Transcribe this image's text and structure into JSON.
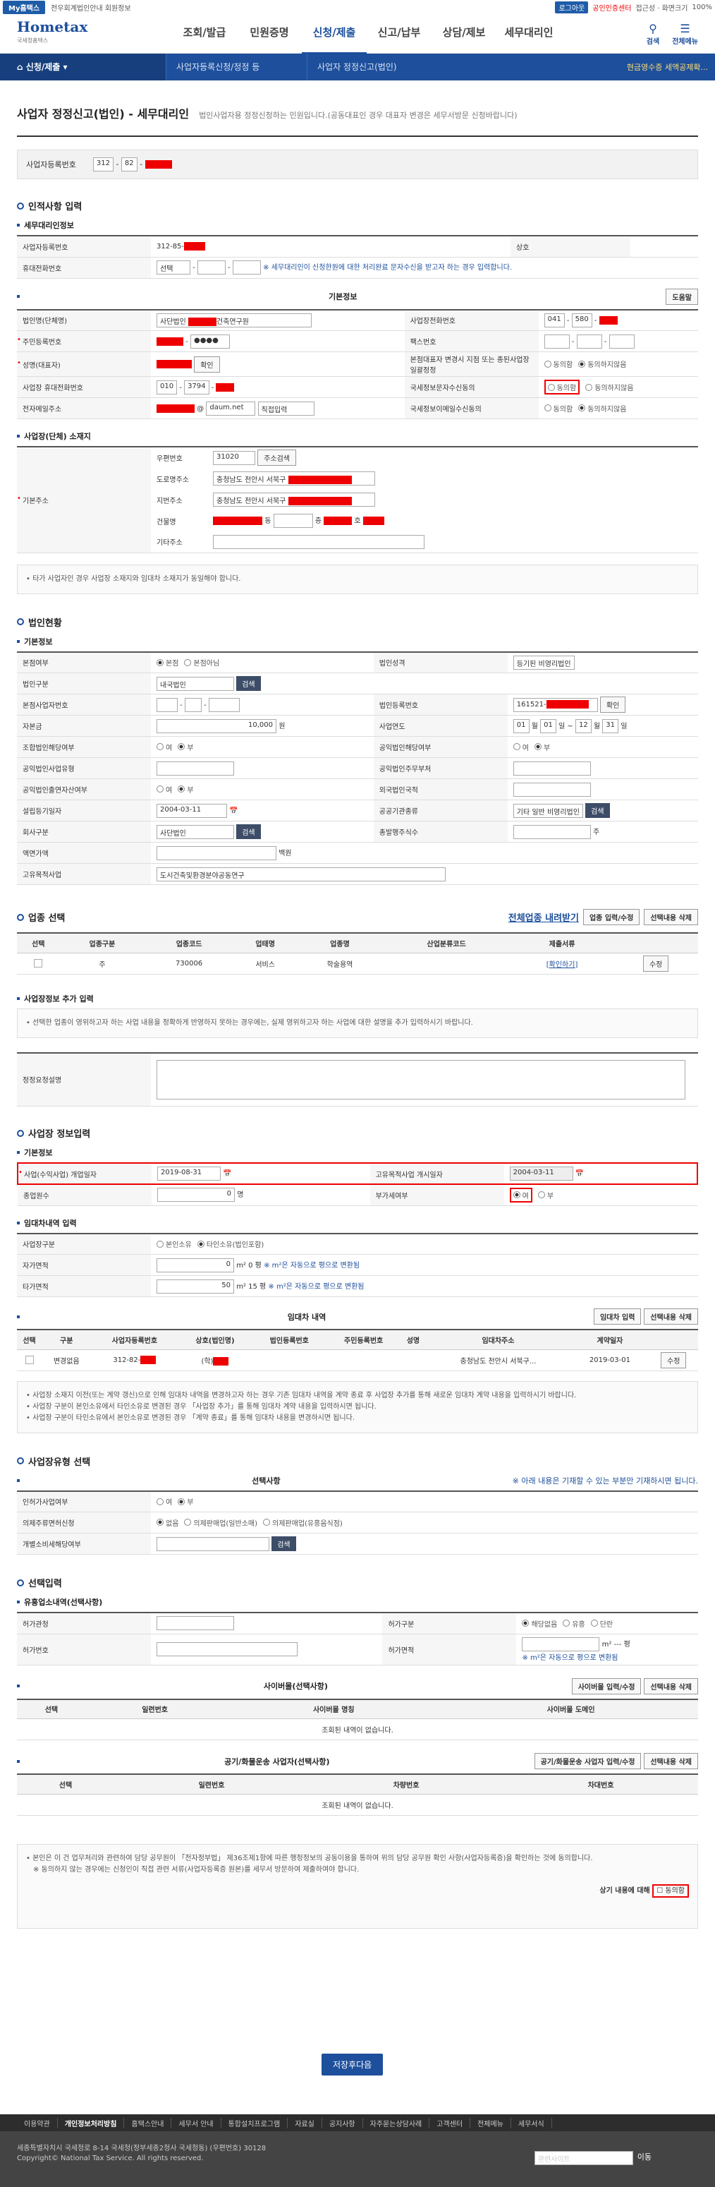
{
  "top": {
    "mytax": "My홈택스",
    "links": "전우회계법인안내  회원정보",
    "login": "로그아웃",
    "cert": "공인인증센터",
    "rest": "접근성 · 화면크기",
    "zoom": "100%"
  },
  "header": {
    "logo": "Hometax",
    "logo_sub": "국세청홈택스",
    "menus": [
      "조회/발급",
      "민원증명",
      "신청/제출",
      "신고/납부",
      "상담/제보",
      "세무대리인"
    ],
    "search": "검색",
    "allmenu": "전체메뉴"
  },
  "crumb": {
    "home": "신청/제출",
    "c1": "사업자등록신청/정정 등",
    "c2": "사업자 정정신고(법인)",
    "right": "현금영수증 세액공제확..."
  },
  "title": "사업자 정정신고(법인) - 세무대리인",
  "title_desc": "법인사업자용 정정신청하는 민원입니다.(공동대표인 경우 대표자 변경은 세무서방문 신청바랍니다)",
  "bizno_label": "사업자등록번호",
  "bizno": [
    "312",
    "82"
  ],
  "s1": {
    "title": "인적사항 입력",
    "agent": "세무대리인정보",
    "agent_bizno_l": "사업자등록번호",
    "agent_bizno": "312-85-",
    "trade_l": "상호",
    "phone_l": "휴대전화번호",
    "phone_sel": "선택",
    "phone_note": "※ 세무대리인이 신청한원에 대한 처리완료 문자수신을 받고자 하는 경우 입력합니다.",
    "basic": "기본정보",
    "help": "도움말",
    "corp_l": "법인명(단체명)",
    "corp": "사단법인",
    "corp2": "건축연구원",
    "biztel_l": "사업장전화번호",
    "biztel": [
      "041",
      "580"
    ],
    "jumin_l": "주민등록번호",
    "fax_l": "팩스번호",
    "rep_l": "성명(대표자)",
    "confirm": "확인",
    "unify_l": "본점대표자 변경시 지점 또는 종된사업장 일괄정정",
    "agree": "동의함",
    "disagree": "동의하지않음",
    "mobile_l": "사업장 휴대전화번호",
    "mobile": [
      "010",
      "3794"
    ],
    "sms_l": "국세정보문자수신동의",
    "email_l": "전자메일주소",
    "email": "daum.net",
    "email_sel": "직접입력",
    "email_agree_l": "국세정보이메일수신동의",
    "addr": "사업장(단체) 소재지",
    "addr_l": "기본주소",
    "zip_l": "우편번호",
    "zip": "31020",
    "zip_btn": "주소검색",
    "road_l": "도로명주소",
    "road": "충청남도 천안시 서북구",
    "lot_l": "지번주소",
    "lot": "충청남도 천안시 서북구",
    "bldg_l": "건물명",
    "dong": "동",
    "cheung": "층",
    "ho": "호",
    "etc_l": "기타주소",
    "addr_note": "• 타가 사업자인 경우 사업장 소재지와 임대차 소재지가 동일해야 합니다."
  },
  "s2": {
    "title": "법인현황",
    "basic": "기본정보",
    "hq_l": "본점여부",
    "hq": "본점",
    "nohq": "본점아님",
    "nature_l": "법인성격",
    "nature": "등기된 비영리법인",
    "kind_l": "법인구분",
    "kind": "내국법인",
    "search": "검색",
    "hqbiz_l": "본점사업자번호",
    "regno_l": "법인등록번호",
    "regno": "161521-",
    "capital_l": "자본금",
    "capital": "10,000",
    "won": "원",
    "fy_l": "사업연도",
    "fy": [
      "01",
      "01",
      "12",
      "31"
    ],
    "m": "월",
    "d": "일",
    "tilde": "~",
    "coop_l": "조합법인해당여부",
    "yes": "여",
    "no": "부",
    "public_l": "공익법인해당여부",
    "pubtype_l": "공익법인사업유형",
    "pubmain_l": "공익법인주무부처",
    "pubforeign_l": "공익법인출연자산여부",
    "foreign_l": "외국법인국적",
    "estdate_l": "설립등기일자",
    "estdate": "2004-03-11",
    "pubinst_l": "공공기관종류",
    "pubinst": "기타 일반 비영리법인",
    "company_l": "회사구분",
    "company": "사단법인",
    "shares_l": "총발행주식수",
    "ju": "주",
    "face_l": "액면가액",
    "face_unit": "백원",
    "purpose_l": "고유목적사업",
    "purpose": "도시건축및환경분야공동연구"
  },
  "s3": {
    "title": "업종 선택",
    "link": "전체업종 내려받기",
    "btn1": "업종 입력/수정",
    "btn2": "선택내용 삭제",
    "cols": [
      "선택",
      "업종구분",
      "업종코드",
      "업태명",
      "업종명",
      "산업분류코드",
      "제출서류"
    ],
    "row": [
      "주",
      "730006",
      "서비스",
      "학술용역",
      "[확인하기]",
      "수정"
    ],
    "extra": "사업장정보 추가 입력",
    "extra_note": "• 선택한 업종이 영위하고자 하는 사업 내용을 정확하게 반영하지 못하는 경우에는, 실제 영위하고자 하는 사업에 대한 설명을 추가 입력하시기 바랍니다.",
    "extra_l": "정정요청설명"
  },
  "s4": {
    "title": "사업장 정보입력",
    "basic": "기본정보",
    "open_l": "사업(수익사업) 개업일자",
    "open": "2019-08-31",
    "start_l": "고유목적사업 개시일자",
    "start": "2004-03-11",
    "emp_l": "종업원수",
    "emp": "0",
    "myeong": "명",
    "vat_l": "부가세여부",
    "vat_yes": "여",
    "vat_no": "부",
    "lease": "임대차내역 입력",
    "own_l": "사업장구분",
    "own": "본인소유",
    "rent": "타인소유(법인포함)",
    "selfarea_l": "자가면적",
    "selfarea": "0",
    "area_unit": "m²",
    "pyeong0": "0 평",
    "conv": "※ m²은 자동으로 평으로 변환됨",
    "otherarea_l": "타가면적",
    "otherarea": "50",
    "pyeong15": "15 평",
    "lease_list": "임대차 내역",
    "lease_btn1": "임대차 입력",
    "lease_btn2": "선택내용 삭제",
    "lcols": [
      "선택",
      "구분",
      "사업자등록번호",
      "상호(법인명)",
      "법인등록번호",
      "주민등록번호",
      "성명",
      "임대차주소",
      "계약일자"
    ],
    "lrow": [
      "변경없음",
      "312-82-",
      "(학)",
      "충청남도 천안시 서북구...",
      "2019-03-01",
      "수정"
    ],
    "lnote1": "사업장 소재지 이전(또는 계약 갱신)으로 인해 임대차 내역을 변경하고자 하는 경우 기존 임대차 내역을 계약 종료 후 사업장 추가를 통해 새로운 임대차 계약 내용을 입력하시기 바랍니다.",
    "lnote2": "사업장 구분이 본인소유에서 타인소유로 변경된 경우 「사업장 추가」를 통해 임대차 계약 내용을 입력하시면 됩니다.",
    "lnote3": "사업장 구분이 타인소유에서 본인소유로 변경된 경우 「계약 종료」를 통해 임대차 내용을 변경하시면 됩니다."
  },
  "s5": {
    "title": "사업장유형 선택",
    "basic": "선택사항",
    "hint": "※ 아래 내용은 기재할 수 있는 부분만 기재하시면 됩니다.",
    "license_l": "인허가사업여부",
    "exempt_l": "의제주류면허신청",
    "none": "없음",
    "ex1": "의제판매업(일반소매)",
    "ex2": "의제판매업(유흥음식점)",
    "tax_l": "개별소비세해당여부",
    "search": "검색"
  },
  "s6": {
    "title": "선택입력",
    "sub": "유흥업소내역(선택사항)",
    "office_l": "허가관청",
    "kind_l": "허가구분",
    "kinds": [
      "해당없음",
      "유흥",
      "단란"
    ],
    "permit_l": "허가번호",
    "area_l": "허가면적",
    "area_unit": "m²",
    "pyeong": "--- 평",
    "conv": "※ m²은 자동으로 평으로 변환됨",
    "cyber": "사이버몰(선택사항)",
    "cyber_btn1": "사이버몰 입력/수정",
    "cyber_btn2": "선택내용 삭제",
    "ccols": [
      "선택",
      "일련번호",
      "사이버몰 명칭",
      "사이버몰 도메인"
    ],
    "empty": "조회된 내역이 없습니다.",
    "ship": "공기/화물운송 사업자(선택사항)",
    "ship_btn1": "공기/화물운송 사업자 입력/수정",
    "ship_btn2": "선택내용 삭제",
    "scols": [
      "선택",
      "일련번호",
      "차량번호",
      "차대번호"
    ]
  },
  "consent": {
    "text": "• 본인은 이 건 업무처리와 관련하여 담당 공무원이 「전자정부법」 제36조제1항에 따른 행정정보의 공동이용을 통하여 위의 담당 공무원 확인 사항(사업자등록증)을 확인하는 것에 동의합니다.",
    "text2": "※ 동의하지 않는 경우에는 신청인이 직접 관련 서류(사업자등록증 원본)를 세무서 방문하여 제출하여야 합니다.",
    "label": "상기 내용에 대해",
    "agree": "동의함"
  },
  "submit": "저장후다음",
  "footer": {
    "links": [
      "이용약관",
      "개인정보처리방침",
      "홈택스안내",
      "세무서 안내",
      "통합설치프로그램",
      "자료실",
      "공지사항",
      "자주묻는상담사례",
      "고객센터",
      "전체메뉴",
      "세무서식"
    ],
    "addr": "세종특별자치시 국세청로 8-14 국세청(정부세종2청사 국세청동) (우편번호) 30128",
    "copy": "Copyright© National Tax Service. All rights reserved.",
    "site": "관련사이트",
    "go": "이동"
  }
}
